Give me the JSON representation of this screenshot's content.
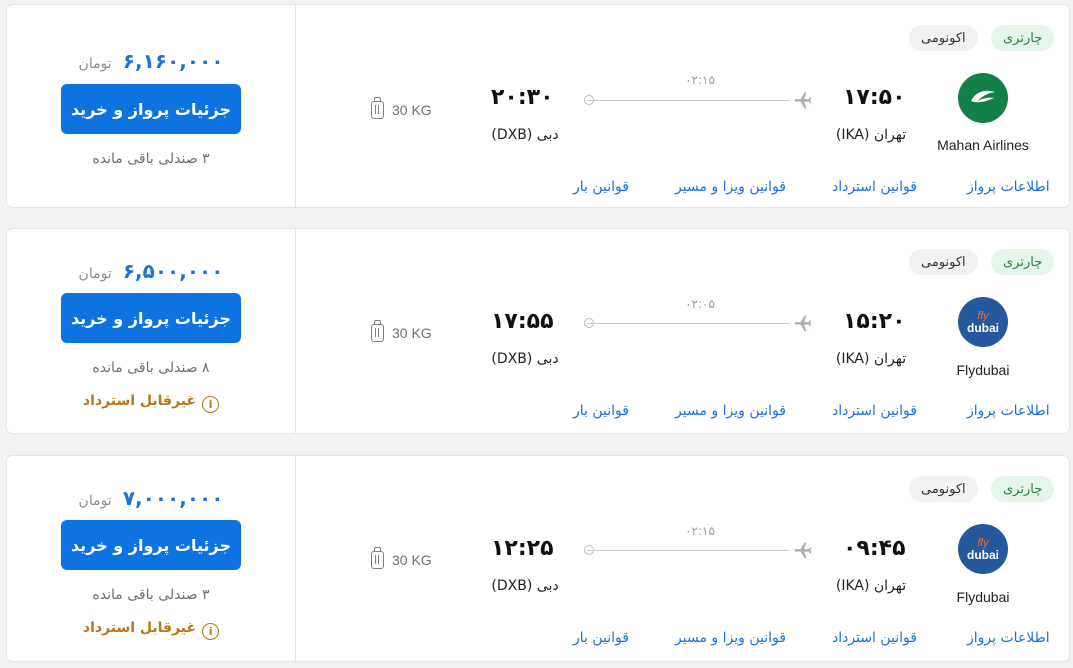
{
  "colors": {
    "accent": "#0c73e0",
    "price": "#1a73d6",
    "charter_green": "#20863f",
    "refund_warning": "#b8751a"
  },
  "flights": [
    {
      "badge_charter": "چارتری",
      "badge_class": "اکونومی",
      "airline_name": "Mahan Airlines",
      "airline_logo": "mahan-logo",
      "dep_time": "۱۷:۵۰",
      "dep_city": "تهران (IKA)",
      "arr_time": "۲۰:۳۰",
      "arr_city": "دبی (DXB)",
      "duration": "۰۲:۱۵",
      "baggage": "30 KG",
      "price": "۶,۱۶۰,۰۰۰",
      "currency": "تومان",
      "buy_label": "جزئیات پرواز و خرید",
      "seats": "۳ صندلی باقی مانده",
      "refund": "",
      "links": [
        "اطلاعات پرواز",
        "قوانین استرداد",
        "قوانین ویزا و مسیر",
        "قوانین بار"
      ]
    },
    {
      "badge_charter": "چارتری",
      "badge_class": "اکونومی",
      "airline_name": "Flydubai",
      "airline_logo": "flydubai-logo",
      "logo_top": "fly",
      "logo_bottom": "dubai",
      "dep_time": "۱۵:۲۰",
      "dep_city": "تهران (IKA)",
      "arr_time": "۱۷:۵۵",
      "arr_city": "دبی (DXB)",
      "duration": "۰۲:۰۵",
      "baggage": "30 KG",
      "price": "۶,۵۰۰,۰۰۰",
      "currency": "تومان",
      "buy_label": "جزئیات پرواز و خرید",
      "seats": "۸ صندلی باقی مانده",
      "refund": "غیرقابل استرداد",
      "links": [
        "اطلاعات پرواز",
        "قوانین استرداد",
        "قوانین ویزا و مسیر",
        "قوانین بار"
      ]
    },
    {
      "badge_charter": "چارتری",
      "badge_class": "اکونومی",
      "airline_name": "Flydubai",
      "airline_logo": "flydubai-logo",
      "logo_top": "fly",
      "logo_bottom": "dubai",
      "dep_time": "۰۹:۴۵",
      "dep_city": "تهران (IKA)",
      "arr_time": "۱۲:۲۵",
      "arr_city": "دبی (DXB)",
      "duration": "۰۲:۱۵",
      "baggage": "30 KG",
      "price": "۷,۰۰۰,۰۰۰",
      "currency": "تومان",
      "buy_label": "جزئیات پرواز و خرید",
      "seats": "۳ صندلی باقی مانده",
      "refund": "غیرقابل استرداد",
      "links": [
        "اطلاعات پرواز",
        "قوانین استرداد",
        "قوانین ویزا و مسیر",
        "قوانین بار"
      ]
    }
  ]
}
